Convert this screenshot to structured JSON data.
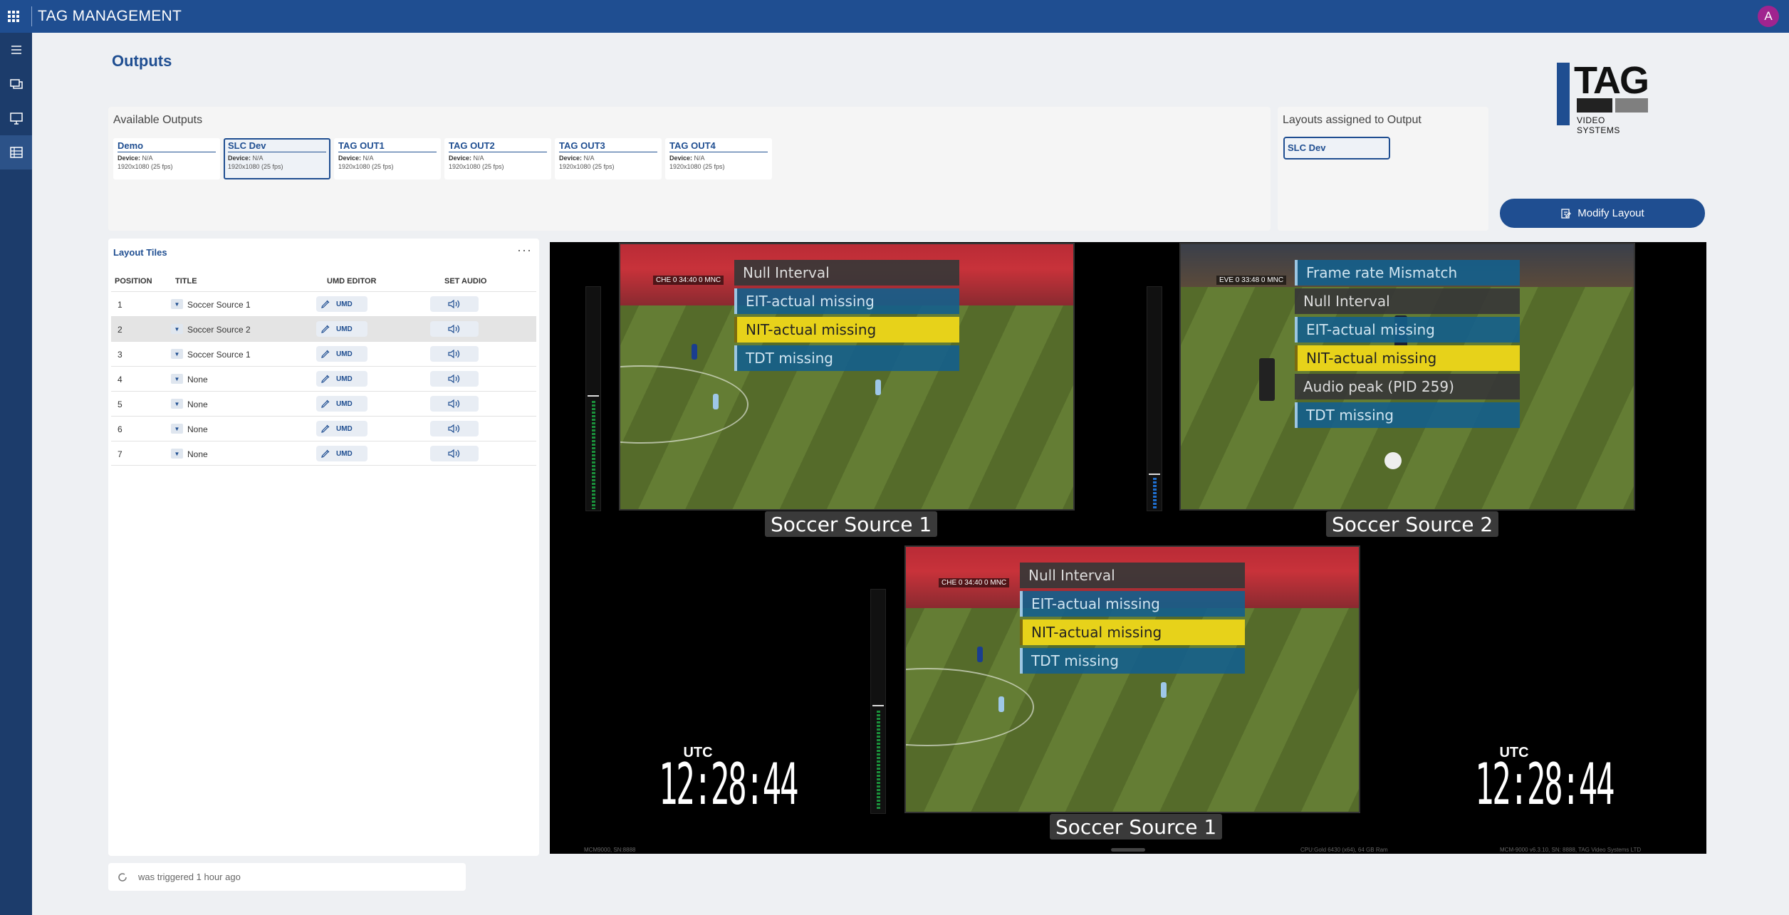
{
  "app": {
    "title": "TAG MANAGEMENT",
    "avatar_initial": "A"
  },
  "page": {
    "title": "Outputs"
  },
  "logo": {
    "wordmark": "TAG",
    "subtitle": "VIDEO SYSTEMS"
  },
  "available_outputs": {
    "label": "Available Outputs",
    "items": [
      {
        "name": "Demo",
        "device_label": "Device:",
        "device": "N/A",
        "resolution": "1920x1080 (25 fps)",
        "selected": false
      },
      {
        "name": "SLC Dev",
        "device_label": "Device:",
        "device": "N/A",
        "resolution": "1920x1080 (25 fps)",
        "selected": true
      },
      {
        "name": "TAG OUT1",
        "device_label": "Device:",
        "device": "N/A",
        "resolution": "1920x1080 (25 fps)",
        "selected": false
      },
      {
        "name": "TAG OUT2",
        "device_label": "Device:",
        "device": "N/A",
        "resolution": "1920x1080 (25 fps)",
        "selected": false
      },
      {
        "name": "TAG OUT3",
        "device_label": "Device:",
        "device": "N/A",
        "resolution": "1920x1080 (25 fps)",
        "selected": false
      },
      {
        "name": "TAG OUT4",
        "device_label": "Device:",
        "device": "N/A",
        "resolution": "1920x1080 (25 fps)",
        "selected": false
      }
    ]
  },
  "assigned": {
    "label": "Layouts assigned to Output",
    "layout": "SLC Dev"
  },
  "modify_button": {
    "label": "Modify Layout"
  },
  "layout_tiles": {
    "title": "Layout Tiles",
    "columns": {
      "position": "POSITION",
      "title": "TITLE",
      "umd": "UMD EDITOR",
      "audio": "SET AUDIO"
    },
    "umd_label": "UMD",
    "rows": [
      {
        "position": "1",
        "title": "Soccer Source 1"
      },
      {
        "position": "2",
        "title": "Soccer Source 2"
      },
      {
        "position": "3",
        "title": "Soccer Source 1"
      },
      {
        "position": "4",
        "title": "None"
      },
      {
        "position": "5",
        "title": "None"
      },
      {
        "position": "6",
        "title": "None"
      },
      {
        "position": "7",
        "title": "None"
      }
    ]
  },
  "status": {
    "text": "was triggered 1 hour ago"
  },
  "preview": {
    "tiles": [
      {
        "label": "Soccer Source 1",
        "score": "CHE 0  34:40  0 MNC",
        "alarms": [
          {
            "text": "Null Interval",
            "kind": "gray"
          },
          {
            "text": "EIT-actual missing",
            "kind": "blue"
          },
          {
            "text": "NIT-actual missing",
            "kind": "yellow"
          },
          {
            "text": "TDT missing",
            "kind": "blue"
          }
        ]
      },
      {
        "label": "Soccer Source 2",
        "score": "EVE 0  33:48  0 MNC",
        "alarms": [
          {
            "text": "Frame rate Mismatch",
            "kind": "blue"
          },
          {
            "text": "Null Interval",
            "kind": "gray"
          },
          {
            "text": "EIT-actual missing",
            "kind": "blue"
          },
          {
            "text": "NIT-actual missing",
            "kind": "yellow"
          },
          {
            "text": "Audio peak (PID 259)",
            "kind": "gray"
          },
          {
            "text": "TDT missing",
            "kind": "blue"
          }
        ]
      },
      {
        "label": "Soccer Source 1",
        "score": "CHE 0  34:40  0 MNC",
        "alarms": [
          {
            "text": "Null Interval",
            "kind": "gray"
          },
          {
            "text": "EIT-actual missing",
            "kind": "blue"
          },
          {
            "text": "NIT-actual missing",
            "kind": "yellow"
          },
          {
            "text": "TDT missing",
            "kind": "blue"
          }
        ]
      }
    ],
    "clock": {
      "zone": "UTC",
      "time": "12:28:44"
    },
    "footer": {
      "left": "MCM9000, SN:8888",
      "middle": "CPU:Gold 6430 (x64), 64 GB Ram",
      "right": "MCM-9000 v6.3.10, SN: 8888, TAG Video Systems LTD"
    }
  },
  "colors": {
    "brand": "#1f4e91",
    "avatar": "#a0248f",
    "alarm_yellow": "#e7d21a",
    "alarm_blue": "#145f8c"
  }
}
